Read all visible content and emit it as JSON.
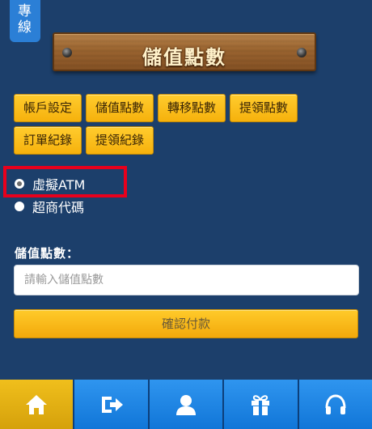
{
  "side_tab": {
    "label": "專線",
    "line1": "專",
    "line2": "線"
  },
  "header": {
    "title": "儲值點數"
  },
  "menu": {
    "row1": [
      "帳戶設定",
      "儲值點數",
      "轉移點數",
      "提領點數"
    ],
    "row2": [
      "訂單紀錄",
      "提領紀錄"
    ]
  },
  "payment": {
    "options": [
      {
        "label": "虛擬ATM",
        "checked": true
      },
      {
        "label": "超商代碼",
        "checked": false
      }
    ]
  },
  "form": {
    "amount_label": "儲值點數：",
    "amount_placeholder": "請輸入儲值點數",
    "amount_value": "",
    "confirm_label": "確認付款"
  },
  "bottom_nav": {
    "items": [
      {
        "icon": "home-icon",
        "active": true
      },
      {
        "icon": "logout-icon",
        "active": false
      },
      {
        "icon": "user-icon",
        "active": false
      },
      {
        "icon": "gift-icon",
        "active": false
      },
      {
        "icon": "headphones-icon",
        "active": false
      }
    ]
  },
  "colors": {
    "background": "#1c3f6b",
    "button_yellow": "#f6b10c",
    "nav_blue": "#1e86e3",
    "nav_active": "#e3b014",
    "highlight_red": "#e8001c"
  }
}
